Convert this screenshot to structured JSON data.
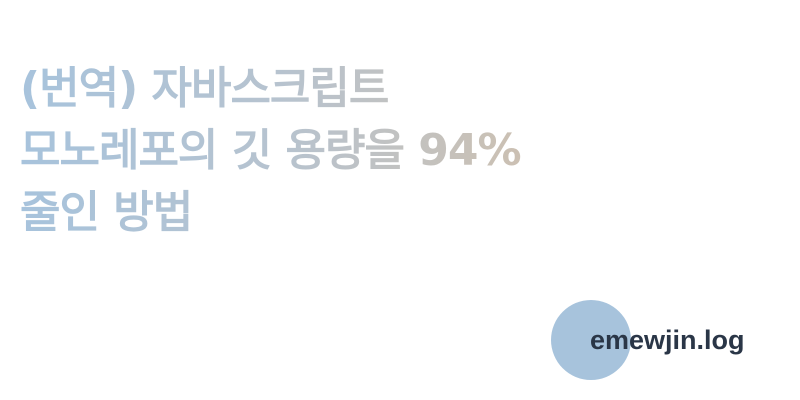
{
  "post": {
    "title_lines": [
      "(번역) 자바스크립트",
      "모노레포의 깃 용량을 94%",
      "줄인 방법"
    ]
  },
  "brand": {
    "name": "emewjin.log"
  },
  "colors": {
    "accent_blue": "#a7c3dc",
    "accent_beige": "#cfc0ae",
    "brand_text": "#2a3647",
    "background": "#ffffff"
  }
}
